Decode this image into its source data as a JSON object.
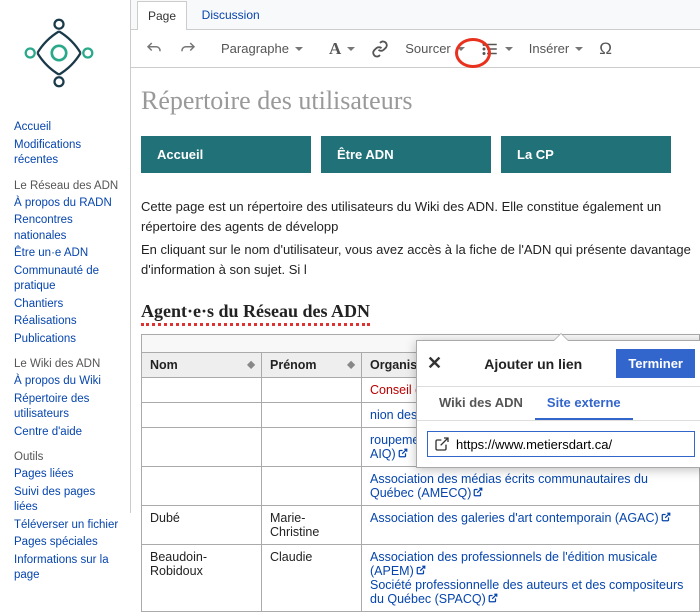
{
  "sidebar": {
    "primary": [
      {
        "label": "Accueil"
      },
      {
        "label": "Modifications récentes"
      }
    ],
    "group1_title": "Le Réseau des ADN",
    "group1": [
      {
        "label": "À propos du RADN"
      },
      {
        "label": "Rencontres nationales"
      },
      {
        "label": "Être un·e ADN"
      },
      {
        "label": "Communauté de pratique"
      },
      {
        "label": "Chantiers"
      },
      {
        "label": "Réalisations"
      },
      {
        "label": "Publications"
      }
    ],
    "group2_title": "Le Wiki des ADN",
    "group2": [
      {
        "label": "À propos du Wiki"
      },
      {
        "label": "Répertoire des utilisateurs"
      },
      {
        "label": "Centre d'aide"
      }
    ],
    "group3_title": "Outils",
    "group3": [
      {
        "label": "Pages liées"
      },
      {
        "label": "Suivi des pages liées"
      },
      {
        "label": "Téléverser un fichier"
      },
      {
        "label": "Pages spéciales"
      },
      {
        "label": "Informations sur la page"
      }
    ]
  },
  "tabs": {
    "page": "Page",
    "discussion": "Discussion"
  },
  "toolbar": {
    "paragraph": "Paragraphe",
    "sourcer": "Sourcer",
    "insert": "Insérer"
  },
  "page_title": "Répertoire des utilisateurs",
  "nav_buttons": {
    "accueil": "Accueil",
    "etre_adn": "Être ADN",
    "la_cp": "La CP"
  },
  "desc_lines": [
    "Cette page est un répertoire des utilisateurs du Wiki des ADN. Elle constitue également un répertoire des agents de développ",
    "En cliquant sur le nom d'utilisateur, vous avez accès à la fiche de l'ADN qui présente davantage d'information à son sujet. Si l"
  ],
  "section_heading": "Agent·e·s du Réseau des ADN",
  "table": {
    "headers": {
      "nom": "Nom",
      "prenom": "Prénom",
      "org": "Organisation"
    },
    "rows": [
      {
        "nom": "",
        "prenom": "",
        "orgs": [
          {
            "text": "Conseil des métiers d'arts du Québec (CMAQ)",
            "red": true,
            "ext": false
          }
        ]
      },
      {
        "nom": "",
        "prenom": "",
        "orgs": [
          {
            "text": "nion des écrivaines et des é",
            "ext": true
          }
        ]
      },
      {
        "nom": "",
        "prenom": "",
        "orgs": [
          {
            "text": "roupement des centres d'ar",
            "ext": false
          },
          {
            "text": "AIQ)",
            "ext": true
          }
        ],
        "truncated": true
      },
      {
        "nom": "",
        "prenom": "",
        "orgs": [
          {
            "text": "Association des médias écrits communautaires du Québec (AMECQ)",
            "ext": true
          }
        ]
      },
      {
        "nom": "Dubé",
        "prenom": "Marie-Christine",
        "orgs": [
          {
            "text": "Association des galeries d'art contemporain (AGAC)",
            "ext": true
          }
        ]
      },
      {
        "nom": "Beaudoin-Robidoux",
        "prenom": "Claudie",
        "orgs": [
          {
            "text": "Association des professionnels de l'édition musicale (APEM)",
            "ext": true
          },
          {
            "text": "Société professionnelle des auteurs et des compositeurs du Québec (SPACQ)",
            "ext": true
          }
        ]
      }
    ]
  },
  "link_dialog": {
    "title": "Ajouter un lien",
    "done": "Terminer",
    "tab_internal": "Wiki des ADN",
    "tab_external": "Site externe",
    "url_value": "https://www.metiersdart.ca/"
  }
}
